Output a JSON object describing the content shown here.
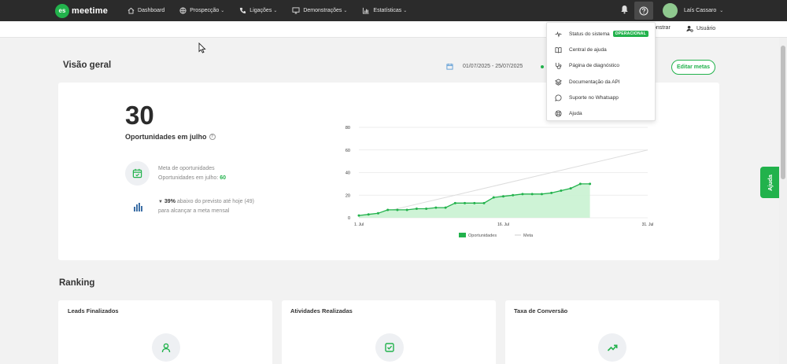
{
  "topnav": {
    "logo_badge": "es",
    "logo_text": "meetime",
    "items": [
      {
        "label": "Dashboard",
        "icon": "home-icon",
        "caret": false
      },
      {
        "label": "Prospecção",
        "icon": "globe-icon",
        "caret": true
      },
      {
        "label": "Ligações",
        "icon": "phone-icon",
        "caret": true
      },
      {
        "label": "Demonstrações",
        "icon": "monitor-icon",
        "caret": true
      },
      {
        "label": "Estatísticas",
        "icon": "bar-chart-icon",
        "caret": true
      }
    ],
    "user_name": "Laís Cassaro"
  },
  "subbar": {
    "demo_label": "onstrar",
    "user_label": "Usuário"
  },
  "help_menu": {
    "items": [
      {
        "label": "Status do sistema",
        "icon": "pulse-icon",
        "badge": "OPERACIONAL"
      },
      {
        "label": "Central de ajuda",
        "icon": "book-icon"
      },
      {
        "label": "Página de diagnóstico",
        "icon": "stethoscope-icon"
      },
      {
        "label": "Documentação da API",
        "icon": "layers-icon"
      },
      {
        "label": "Suporte no Whatsapp",
        "icon": "whatsapp-icon"
      },
      {
        "label": "Ajuda",
        "icon": "lifebuoy-icon"
      }
    ]
  },
  "overview": {
    "title": "Visão geral",
    "date_range": "01/07/2025 - 25/07/2025",
    "edit_button": "Editar metas",
    "big_number": "30",
    "big_label": "Oportunidades em julho",
    "meta_line1": "Meta de oportunidades",
    "meta_line2_prefix": "Oportunidades em julho: ",
    "meta_line2_value": "60",
    "prev_pct": "39%",
    "prev_rest": " abaixo do previsto até hoje (49)",
    "prev_line2": "para alcançar a meta mensal"
  },
  "chart_data": {
    "type": "area",
    "x_tick_labels": [
      "1. Jul",
      "16. Jul",
      "31. Jul"
    ],
    "y_ticks": [
      0,
      20,
      40,
      60,
      80
    ],
    "ylim": [
      0,
      80
    ],
    "xlim": [
      1,
      31
    ],
    "series": [
      {
        "name": "Oportunidades",
        "color": "#22b24c",
        "x": [
          1,
          2,
          3,
          4,
          5,
          6,
          7,
          8,
          9,
          10,
          11,
          12,
          13,
          14,
          15,
          16,
          17,
          18,
          19,
          20,
          21,
          22,
          23,
          24,
          25
        ],
        "values": [
          2,
          3,
          4,
          7,
          7,
          7,
          8,
          8,
          9,
          9,
          13,
          13,
          13,
          13,
          18,
          19,
          20,
          21,
          21,
          21,
          22,
          24,
          26,
          30,
          30
        ]
      },
      {
        "name": "Meta",
        "color": "#dddddd",
        "x": [
          1,
          31
        ],
        "values": [
          0,
          60
        ]
      }
    ],
    "legend": [
      "Oportunidades",
      "Meta"
    ],
    "legend_position": "bottom"
  },
  "ranking": {
    "title": "Ranking",
    "cards": [
      {
        "title": "Leads Finalizados",
        "icon": "user-icon"
      },
      {
        "title": "Atividades Realizadas",
        "icon": "checkbox-icon"
      },
      {
        "title": "Taxa de Conversão",
        "icon": "trend-up-icon"
      }
    ]
  },
  "side_tab": "Ajuda",
  "colors": {
    "accent": "#22b24c",
    "nav_bg": "#2b2b2b",
    "page_bg": "#f2f2f2"
  }
}
